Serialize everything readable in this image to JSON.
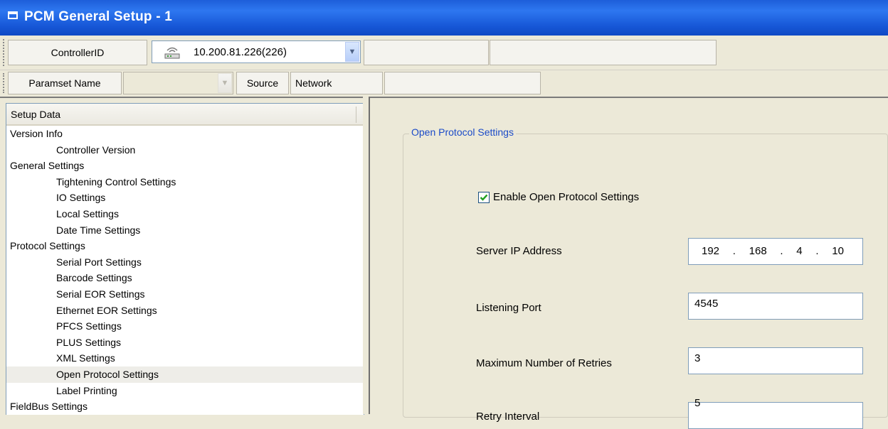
{
  "window": {
    "title": "PCM General Setup - 1"
  },
  "toolbar": {
    "controller_label": "ControllerID",
    "controller_value": "10.200.81.226(226)",
    "controller_icon": "router-icon",
    "paramset_label": "Paramset Name",
    "paramset_value": "",
    "source_label": "Source",
    "source_value": "Network"
  },
  "tree": {
    "header": "Setup Data",
    "items": [
      {
        "label": "Version Info",
        "level": 0
      },
      {
        "label": "Controller Version",
        "level": 1
      },
      {
        "label": "General Settings",
        "level": 0
      },
      {
        "label": "Tightening Control Settings",
        "level": 1
      },
      {
        "label": "IO Settings",
        "level": 1
      },
      {
        "label": "Local Settings",
        "level": 1
      },
      {
        "label": "Date Time Settings",
        "level": 1
      },
      {
        "label": "Protocol Settings",
        "level": 0
      },
      {
        "label": "Serial Port Settings",
        "level": 1
      },
      {
        "label": "Barcode Settings",
        "level": 1
      },
      {
        "label": "Serial EOR Settings",
        "level": 1
      },
      {
        "label": "Ethernet EOR Settings",
        "level": 1
      },
      {
        "label": "PFCS Settings",
        "level": 1
      },
      {
        "label": "PLUS Settings",
        "level": 1
      },
      {
        "label": "XML Settings",
        "level": 1
      },
      {
        "label": "Open Protocol Settings",
        "level": 1,
        "selected": true
      },
      {
        "label": "Label Printing",
        "level": 1
      },
      {
        "label": "FieldBus Settings",
        "level": 0
      }
    ]
  },
  "panel": {
    "group_title": "Open Protocol Settings",
    "enable_label": "Enable Open Protocol Settings",
    "enable_checked": true,
    "server_ip_label": "Server IP Address",
    "server_ip": [
      "192",
      "168",
      "4",
      "10"
    ],
    "ip_dot": ".",
    "listening_port_label": "Listening Port",
    "listening_port": "4545",
    "max_retries_label": "Maximum Number of Retries",
    "max_retries": "3",
    "retry_interval_label": "Retry Interval",
    "retry_interval": "5"
  },
  "colors": {
    "titlebar": "#2e77f0",
    "group_title": "#1b4bc8",
    "checkbox_check": "#21a121"
  }
}
